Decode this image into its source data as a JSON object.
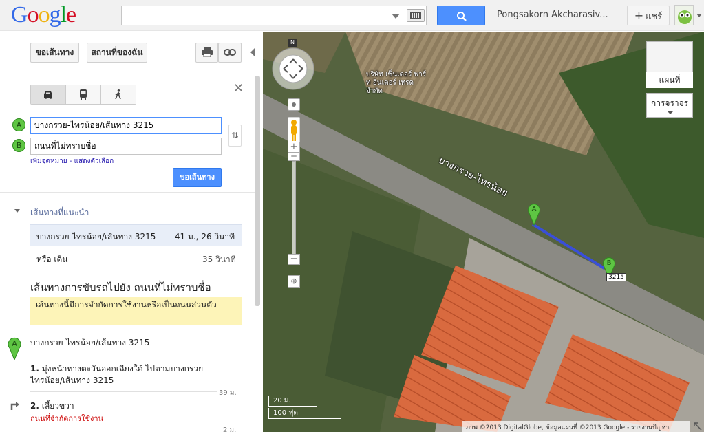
{
  "header": {
    "logo": [
      "G",
      "o",
      "o",
      "g",
      "l",
      "e"
    ],
    "search_value": "",
    "username": "Pongsakorn Akcharasiv...",
    "share_label": "แชร์"
  },
  "panel": {
    "directions_button": "ขอเส้นทาง",
    "my_places_button": "สถานที่ของฉัน",
    "origin_marker": "A",
    "destination_marker": "B",
    "origin_value": "บางกรวย-ไทรน้อย/เส้นทาง 3215",
    "destination_value": "ถนนที่ไม่ทราบชื่อ",
    "add_links": "เพิ่มจุดหมาย - แสดงตัวเลือก",
    "get_directions_button": "ขอเส้นทาง",
    "suggested_title": "เส้นทางที่แนะนำ",
    "route": {
      "name": "บางกรวย-ไทรน้อย/เส้นทาง 3215",
      "time": "41 ม., 26 วินาที"
    },
    "walk": {
      "label": "หรือ เดิน",
      "time": "35 วินาที"
    },
    "directions_title": "เส้นทางการขับรถไปยัง ถนนที่ไม่ทราบชื่อ",
    "warning": "เส้นทางนี้มีการจำกัดการใช้งานหรือเป็นถนนส่วนตัว",
    "start_label": "บางกรวย-ไทรน้อย/เส้นทาง 3215",
    "steps": [
      {
        "num": "1.",
        "text": "มุ่งหน้าทางตะวันออกเฉียงใต้ ไปตามบางกรวย-ไทรน้อย/เส้นทาง 3215",
        "dist": "39 ม."
      },
      {
        "num": "2.",
        "text": "เลี้ยวขวา",
        "sub": "ถนนที่จำกัดการใช้งาน",
        "dist": "2 ม."
      }
    ]
  },
  "map": {
    "layer_label": "แผนที่",
    "traffic_label": "การจราจร",
    "compass": "N",
    "road_label": "บางกรวย-ไทรน้อย",
    "poi_label": "บริษัท เซ็นเตอร์ พาร์ท อินเตอร์ เทรด จำกัด",
    "marker_a": "A",
    "marker_b": "B",
    "shield": "3215",
    "scale_top": "20 ม.",
    "scale_bottom": "100 ฟุต",
    "attribution": "ภาพ ©2013 DigitalGlobe, ข้อมูลแผนที่ ©2013 Google - รายงานปัญหา"
  },
  "colors": {
    "accent_blue": "#4d90fe",
    "marker_green": "#5ec543",
    "warning_bg": "#fdf4b8",
    "route_line": "#3a4fd8"
  }
}
